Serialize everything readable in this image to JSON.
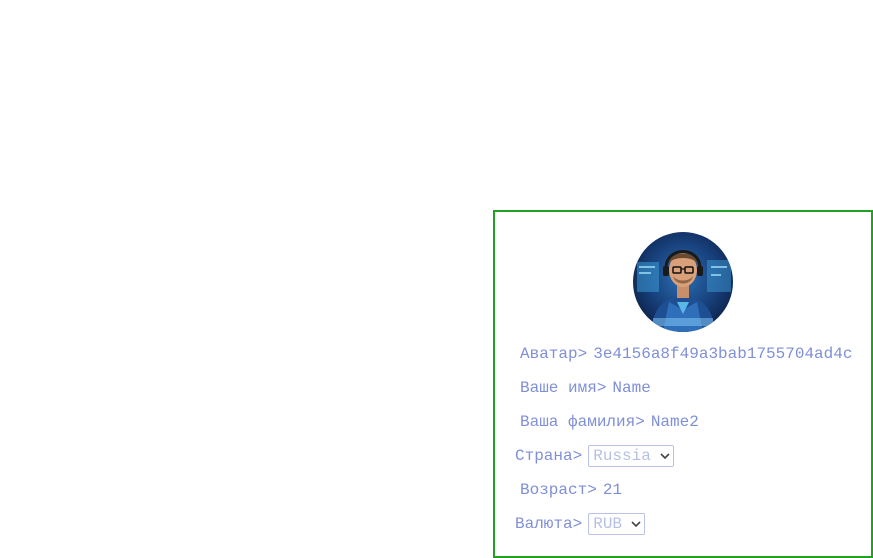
{
  "profile": {
    "avatar_label": "Аватар>",
    "avatar_value": "3e4156a8f49a3bab1755704ad4c",
    "first_name_label": "Ваше имя>",
    "first_name_value": "Name",
    "last_name_label": "Ваша фамилия>",
    "last_name_value": "Name2",
    "country_label": "Страна>",
    "country_selected": "Russia",
    "age_label": "Возраст>",
    "age_value": "21",
    "currency_label": "Валюта>",
    "currency_selected": "RUB"
  },
  "colors": {
    "panel_border": "#21a121",
    "text": "#7f8fd8",
    "select_text": "#b6bfe6"
  },
  "icons": {
    "avatar_image": "person-at-computer-photo",
    "select_chevron": "chevron-down-icon"
  }
}
